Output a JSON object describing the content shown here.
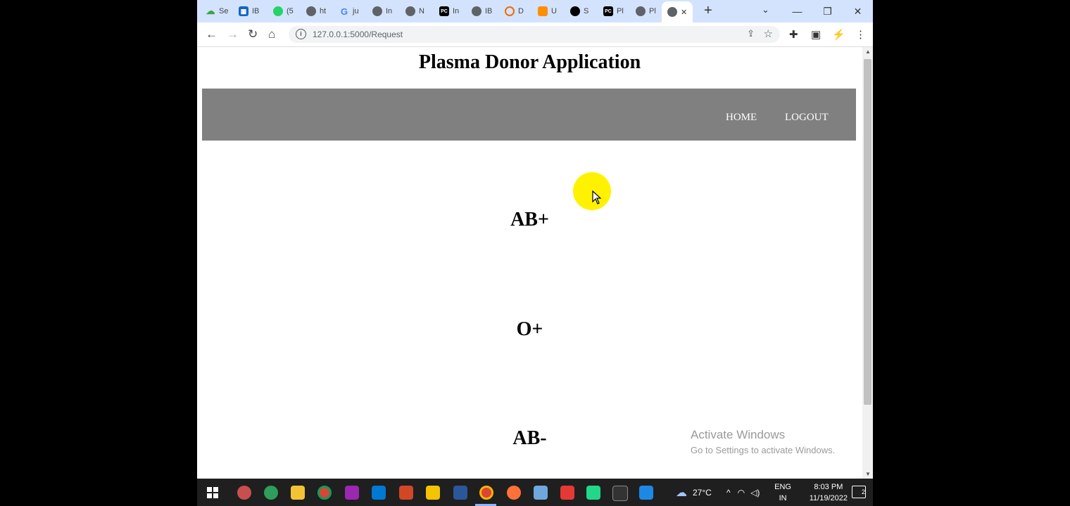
{
  "browser": {
    "tabs": [
      {
        "label": "Se",
        "color": "#43a047",
        "glyph": "☁"
      },
      {
        "label": "IB",
        "color": "#1565c0",
        "glyph": "▦"
      },
      {
        "label": "(5",
        "color": "#25d366",
        "glyph": "●"
      },
      {
        "label": "ht",
        "color": "#5f6368",
        "glyph": "◍"
      },
      {
        "label": "ju",
        "color": "#4285f4",
        "glyph": "G"
      },
      {
        "label": "In",
        "color": "#5f6368",
        "glyph": "◍"
      },
      {
        "label": "N",
        "color": "#5f6368",
        "glyph": "◍"
      },
      {
        "label": "In",
        "color": "#000000",
        "glyph": "PC"
      },
      {
        "label": "IB",
        "color": "#5f6368",
        "glyph": "◍"
      },
      {
        "label": "D",
        "color": "#ef6c00",
        "glyph": "◌"
      },
      {
        "label": "U",
        "color": "#ff8f00",
        "glyph": "▰"
      },
      {
        "label": "S",
        "color": "#000000",
        "glyph": "◉"
      },
      {
        "label": "Pl",
        "color": "#000000",
        "glyph": "PC"
      },
      {
        "label": "Pl",
        "color": "#5f6368",
        "glyph": "◍"
      }
    ],
    "active_tab_close": "✕",
    "new_tab": "+",
    "url": "127.0.0.1:5000/Request",
    "window_controls": [
      "—",
      "❐",
      "✕"
    ]
  },
  "page": {
    "title": "Plasma Donor Application",
    "nav": {
      "home": "HOME",
      "logout": "LOGOUT"
    },
    "blood_types": [
      "AB+",
      "O+",
      "AB-"
    ]
  },
  "watermark": {
    "line1": "Activate Windows",
    "line2": "Go to Settings to activate Windows."
  },
  "taskbar": {
    "weather": "27°C",
    "lang1": "ENG",
    "lang2": "IN",
    "time": "8:03 PM",
    "date": "11/19/2022",
    "notifications": "2"
  }
}
